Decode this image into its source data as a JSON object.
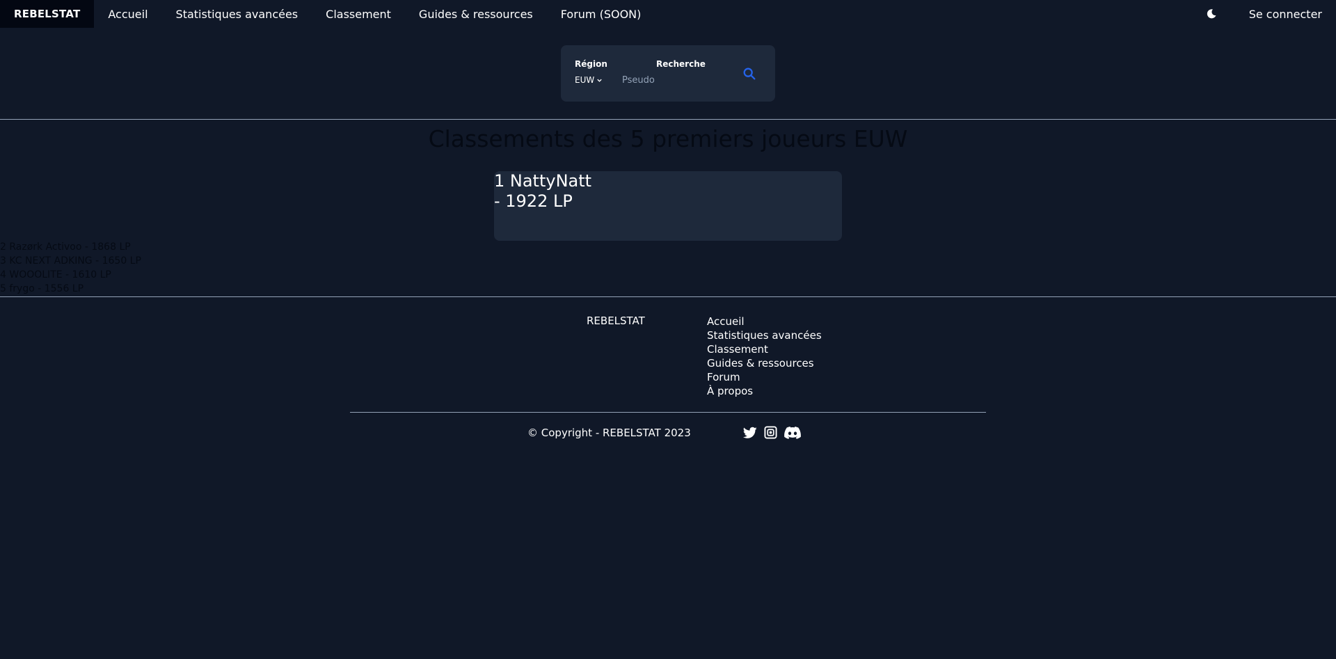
{
  "nav": {
    "brand": "REBELSTAT",
    "links": [
      "Accueil",
      "Statistiques avancées",
      "Classement",
      "Guides & ressources",
      "Forum (SOON)"
    ],
    "login": "Se connecter"
  },
  "search": {
    "region_label": "Région",
    "region_value": "EUW",
    "search_label": "Recherche",
    "placeholder": "Pseudo"
  },
  "ranking": {
    "title": "Classements des 5 premiers joueurs EUW",
    "top_line1": "1 NattyNatt",
    "top_line2": "- 1922 LP",
    "others": [
      "2 Razørk Activoo - 1868 LP",
      "3 KC NEXT ADKING - 1650 LP",
      "4 WOOOLITE - 1610 LP",
      "5 frygo - 1556 LP"
    ]
  },
  "footer": {
    "brand": "REBELSTAT",
    "links": [
      "Accueil",
      "Statistiques avancées",
      "Classement",
      "Guides & ressources",
      "Forum",
      "À propos"
    ],
    "copyright": "© Copyright - REBELSTAT 2023"
  },
  "colors": {
    "background": "#101828",
    "card": "#1e293b",
    "accent": "#2563eb",
    "dark_text": "#050a14"
  },
  "icons": [
    "moon-icon",
    "search-icon",
    "twitter-icon",
    "instagram-icon",
    "discord-icon",
    "chevron-down-icon"
  ]
}
